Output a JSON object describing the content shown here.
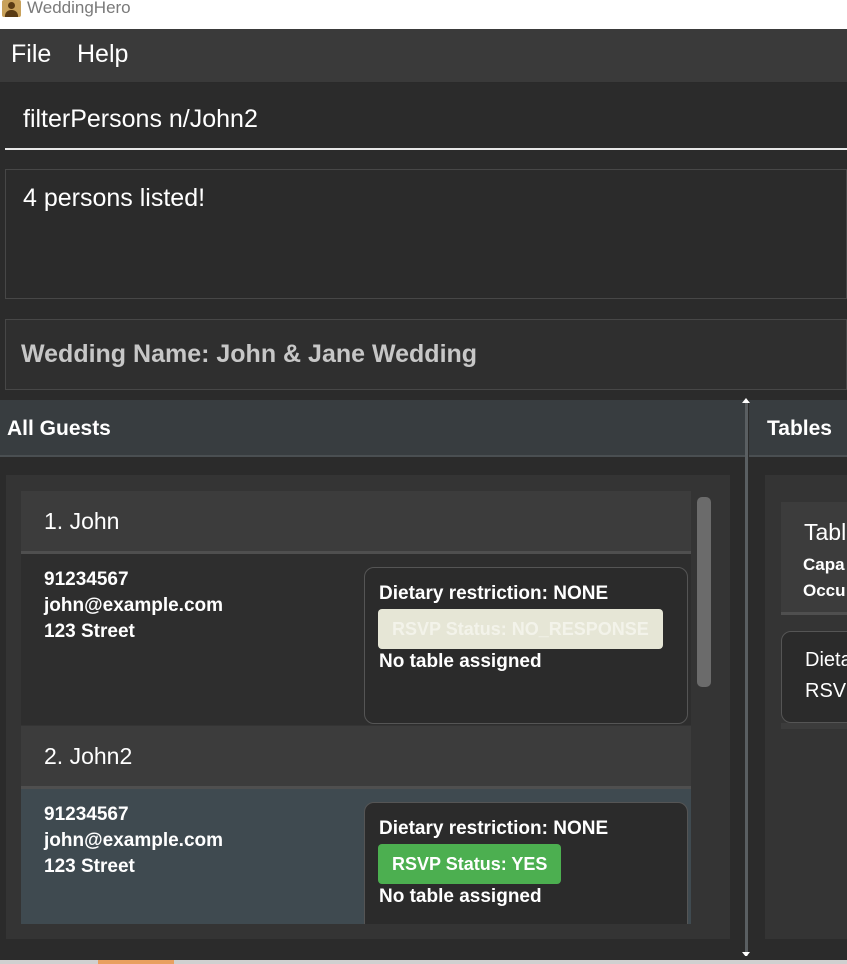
{
  "window": {
    "title": "WeddingHero"
  },
  "menu": {
    "items": [
      "File",
      "Help"
    ]
  },
  "command_box": {
    "value": "filterPersons n/John2"
  },
  "result_display": {
    "text": "4 persons listed!"
  },
  "wedding": {
    "label": "Wedding Name: John & Jane Wedding"
  },
  "guests_panel": {
    "title": "All Guests",
    "persons": [
      {
        "name": "1. John",
        "phone": "91234567",
        "email": "john@example.com",
        "address": "123 Street",
        "dietary": "Dietary restriction: NONE",
        "rsvp": "RSVP Status: NO_RESPONSE",
        "table": "No table assigned"
      },
      {
        "name": "2. John2",
        "phone": "91234567",
        "email": "john@example.com",
        "address": "123 Street",
        "dietary": "Dietary restriction: NONE",
        "rsvp": "RSVP Status: YES",
        "table": "No table assigned"
      }
    ]
  },
  "tables_panel": {
    "title": "Tables",
    "card": {
      "title": "Tabl",
      "line1": "Capa",
      "line2": "Occu"
    },
    "guest": {
      "line1": "Dieta",
      "line2": "RSVI"
    }
  },
  "colors": {
    "rsvp_yes": "#4caf50",
    "rsvp_no_response": "#e6e6d6",
    "background": "#2b2b2b",
    "selected_card": "#3f4a50"
  }
}
